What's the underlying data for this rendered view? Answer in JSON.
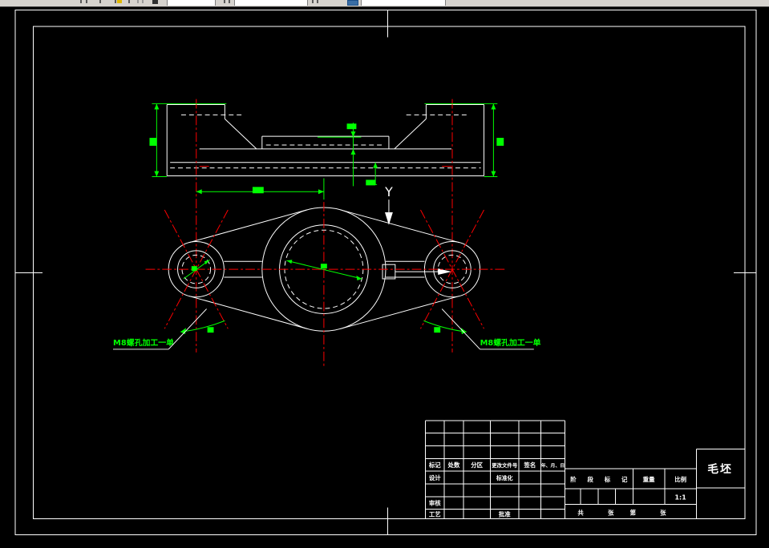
{
  "app": {
    "description": "CAD drawing canvas showing a casting blank drawing",
    "colors": {
      "canvas_bg": "#000000",
      "line": "#ffffff",
      "centerline": "#ff0000",
      "dimension": "#00ff00",
      "toolbar_bg": "#d6d3ce"
    },
    "toolbar_icons": [
      "yellow-pencil-icon",
      "blue-app-icon"
    ]
  },
  "drawing": {
    "datum_label": "Y",
    "note_left": "M8螺孔加工一单",
    "note_right": "M8螺孔加工一单"
  },
  "title_block": {
    "header_row": [
      "标记",
      "处数",
      "分区",
      "更改文件号",
      "签名",
      "年、月、日"
    ],
    "design_label": "设计",
    "standardization_label": "标准化",
    "review_label": "审核",
    "process_label": "工艺",
    "approve_label": "批准",
    "stage_mark_label": "阶段标记",
    "weight_label": "重量",
    "scale_label": "比例",
    "scale_value": "1:1",
    "sheets_total_label": "共",
    "sheets_total_unit": "张",
    "sheet_no_label": "第",
    "sheet_no_unit": "张",
    "part_name": "毛坯"
  }
}
